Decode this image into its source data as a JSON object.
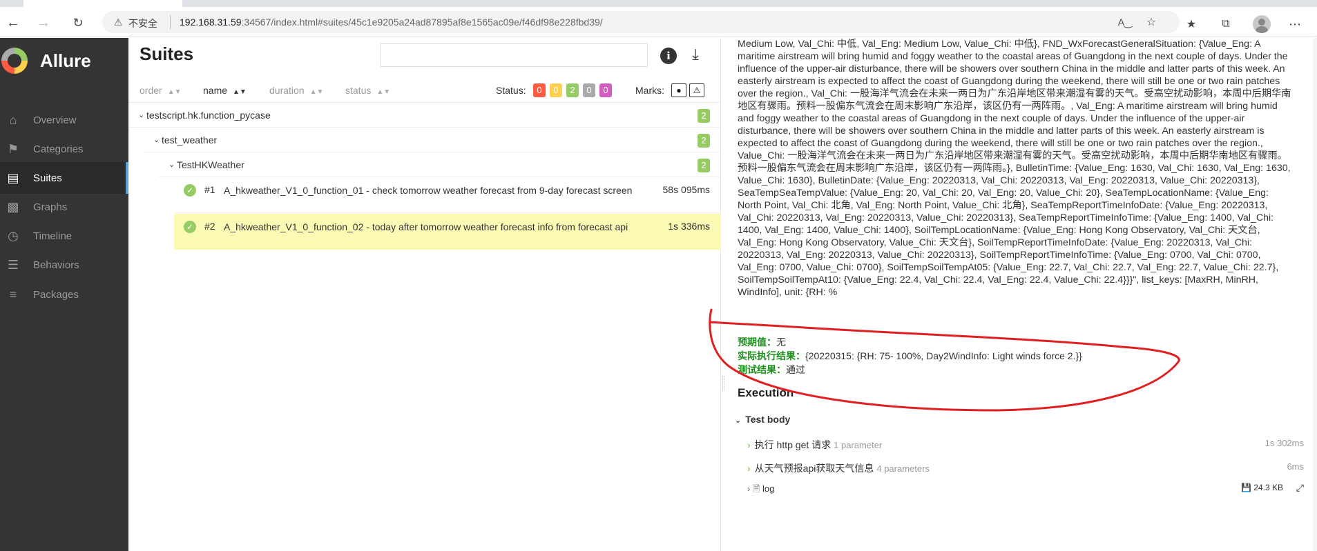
{
  "browser": {
    "insecure_label": "不安全",
    "url_host": "192.168.31.59",
    "url_rest": ":34567/index.html#suites/45c1e9205a24ad87895af8e1565ac09e/f46df98e228fbd39/",
    "icons": [
      "back-icon",
      "forward-icon",
      "reload-icon",
      "warning-icon",
      "read-aloud-icon",
      "favorite-add-icon",
      "favorites-icon",
      "collections-icon",
      "profile-icon",
      "more-icon"
    ]
  },
  "sidebar": {
    "logo": "Allure",
    "items": [
      {
        "label": "Overview",
        "icon": "home-icon"
      },
      {
        "label": "Categories",
        "icon": "flag-icon"
      },
      {
        "label": "Suites",
        "icon": "briefcase-icon",
        "active": true
      },
      {
        "label": "Graphs",
        "icon": "bar-chart-icon"
      },
      {
        "label": "Timeline",
        "icon": "clock-icon"
      },
      {
        "label": "Behaviors",
        "icon": "list-icon"
      },
      {
        "label": "Packages",
        "icon": "align-left-icon"
      }
    ]
  },
  "suites": {
    "title": "Suites",
    "sort": {
      "order": "order",
      "name": "name",
      "duration": "duration",
      "status": "status"
    },
    "status_label": "Status:",
    "status_counts": [
      {
        "value": "0",
        "color": "#fd5a3e"
      },
      {
        "value": "0",
        "color": "#ffd050"
      },
      {
        "value": "2",
        "color": "#97cc64"
      },
      {
        "value": "0",
        "color": "#aaaaaa"
      },
      {
        "value": "0",
        "color": "#d35ebe"
      }
    ],
    "marks_label": "Marks:",
    "tree": [
      {
        "name": "testscript.hk.function_pycase",
        "count": "2"
      },
      {
        "name": "test_weather",
        "count": "2"
      },
      {
        "name": "TestHKWeather",
        "count": "2"
      }
    ],
    "cases": [
      {
        "num": "#1",
        "name": "A_hkweather_V1_0_function_01 - check tomorrow weather forecast from 9-day forecast screen",
        "duration": "58s 095ms"
      },
      {
        "num": "#2",
        "name": "A_hkweather_V1_0_function_02 - today after tomorrow weather forecast info from forecast api",
        "duration": "1s 336ms"
      }
    ]
  },
  "detail": {
    "long_text": "Medium Low, Val_Chi: 中低, Val_Eng: Medium Low, Value_Chi: 中低}, FND_WxForecastGeneralSituation: {Value_Eng: A maritime airstream will bring humid and foggy weather to the coastal areas of Guangdong in the next couple of days. Under the influence of the upper-air disturbance, there will be showers over southern China in the middle and latter parts of this week. An easterly airstream is expected to affect the coast of Guangdong during the weekend, there will still be one or two rain patches over the region., Val_Chi: 一股海洋气流会在未来一两日为广东沿岸地区带来潮湿有雾的天气。受高空扰动影响，本周中后期华南地区有骤雨。预料一股偏东气流会在周末影响广东沿岸，该区仍有一两阵雨。, Val_Eng: A maritime airstream will bring humid and foggy weather to the coastal areas of Guangdong in the next couple of days. Under the influence of the upper-air disturbance, there will be showers over southern China in the middle and latter parts of this week. An easterly airstream is expected to affect the coast of Guangdong during the weekend, there will still be one or two rain patches over the region., Value_Chi: 一股海洋气流会在未来一两日为广东沿岸地区带来潮湿有雾的天气。受高空扰动影响，本周中后期华南地区有骤雨。预料一股偏东气流会在周末影响广东沿岸，该区仍有一两阵雨。}, BulletinTime: {Value_Eng: 1630, Val_Chi: 1630, Val_Eng: 1630, Value_Chi: 1630}, BulletinDate: {Value_Eng: 20220313, Val_Chi: 20220313, Val_Eng: 20220313, Value_Chi: 20220313}, SeaTempSeaTempValue: {Value_Eng: 20, Val_Chi: 20, Val_Eng: 20, Value_Chi: 20}, SeaTempLocationName: {Value_Eng: North Point, Val_Chi: 北角, Val_Eng: North Point, Value_Chi: 北角}, SeaTempReportTimeInfoDate: {Value_Eng: 20220313, Val_Chi: 20220313, Val_Eng: 20220313, Value_Chi: 20220313}, SeaTempReportTimeInfoTime: {Value_Eng: 1400, Val_Chi: 1400, Val_Eng: 1400, Value_Chi: 1400}, SoilTempLocationName: {Value_Eng: Hong Kong Observatory, Val_Chi: 天文台, Val_Eng: Hong Kong Observatory, Value_Chi: 天文台}, SoilTempReportTimeInfoDate: {Value_Eng: 20220313, Val_Chi: 20220313, Val_Eng: 20220313, Value_Chi: 20220313}, SoilTempReportTimeInfoTime: {Value_Eng: 0700, Val_Chi: 0700, Val_Eng: 0700, Value_Chi: 0700}, SoilTempSoilTempAt05: {Value_Eng: 22.7, Val_Chi: 22.7, Val_Eng: 22.7, Value_Chi: 22.7}, SoilTempSoilTempAt10: {Value_Eng: 22.4, Val_Chi: 22.4, Val_Eng: 22.4, Value_Chi: 22.4}}}\", list_keys: [MaxRH, MinRH, WindInfo], unit: {RH: %",
    "expected_label": "预期值：",
    "expected_value": "无",
    "actual_label": "实际执行结果：",
    "actual_value": "{20220315: {RH: 75- 100%, Day2WindInfo: Light winds force 2.}}",
    "result_label": "测试结果：",
    "result_value": "通过",
    "execution_title": "Execution",
    "test_body_label": "Test body",
    "steps": [
      {
        "name": "执行 http get 请求",
        "params": "1 parameter",
        "duration": "1s 302ms"
      },
      {
        "name": "从天气预报api获取天气信息",
        "params": "4 parameters",
        "duration": "6ms"
      }
    ],
    "log": {
      "name": "log",
      "size": "24.3 KB"
    },
    "annotation_color": "#e02020"
  }
}
